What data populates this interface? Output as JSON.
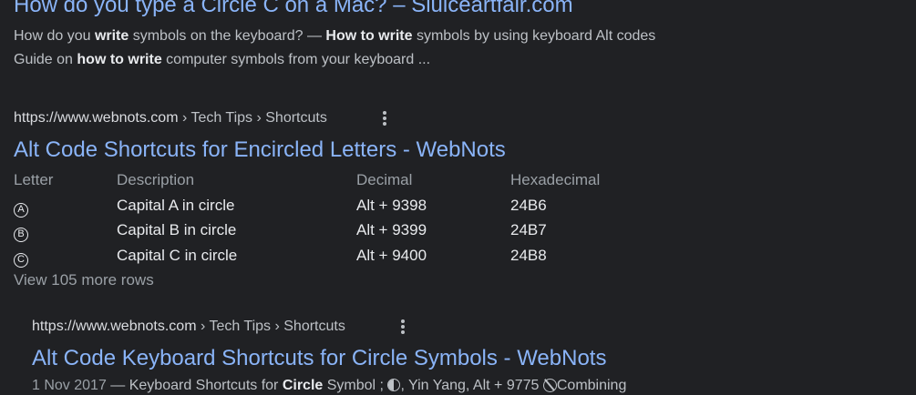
{
  "result1": {
    "title": "How do you type a Circle C on a Mac? – Sluiceartfair.com",
    "snippet": {
      "p1": "How do you ",
      "b1": "write",
      "p2": " symbols on the keyboard? — ",
      "b2": "How to write",
      "p3": " symbols by using keyboard Alt codes Guide on ",
      "b3": "how to write",
      "p4": " computer symbols from your keyboard ..."
    }
  },
  "result2": {
    "domain": "https://www.webnots.com",
    "path": " › Tech Tips › Shortcuts",
    "title": "Alt Code Shortcuts for Encircled Letters - WebNots",
    "table": {
      "headers": {
        "letter": "Letter",
        "description": "Description",
        "decimal": "Decimal",
        "hex": "Hexadecimal"
      },
      "rows": [
        {
          "letter": "A",
          "description": "Capital A in circle",
          "decimal": "Alt + 9398",
          "hex": "24B6"
        },
        {
          "letter": "B",
          "description": "Capital B in circle",
          "decimal": "Alt + 9399",
          "hex": "24B7"
        },
        {
          "letter": "C",
          "description": "Capital C in circle",
          "decimal": "Alt + 9400",
          "hex": "24B8"
        }
      ],
      "more_rows": "View 105 more rows"
    }
  },
  "result3": {
    "domain": "https://www.webnots.com",
    "path": " › Tech Tips › Shortcuts",
    "title": "Alt Code Keyboard Shortcuts for Circle Symbols - WebNots",
    "snippet": {
      "date": "1 Nov 2017",
      "dash": " — Keyboard Shortcuts for ",
      "bold": "Circle",
      "rest": " Symbol ; ",
      "after_icon": ", Yin Yang, Alt + 9775 ",
      "tail": "Combining"
    }
  },
  "icons": {
    "more_options": "more-vert-icon",
    "yin_yang": "yin-yang-icon",
    "combining": "combining-circle-slash-icon"
  },
  "colors": {
    "background": "#202124",
    "link": "#8ab4f8",
    "text": "#bdc1c6",
    "strong_text": "#e8eaed",
    "muted": "#9aa0a6"
  }
}
